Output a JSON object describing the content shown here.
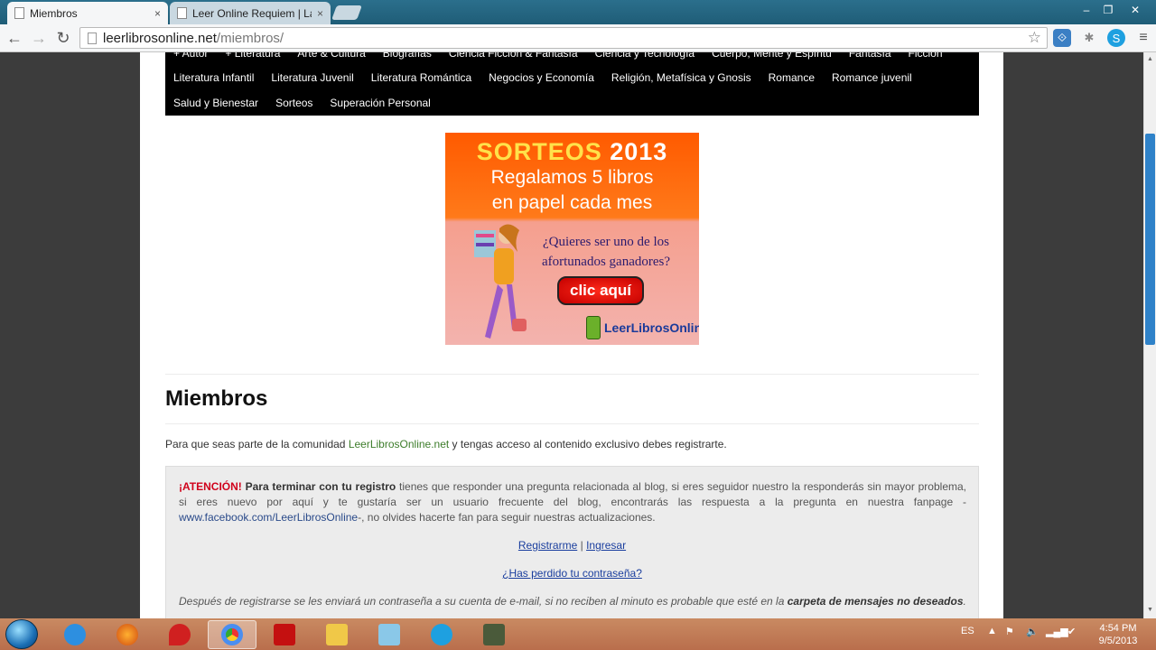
{
  "browser": {
    "tabs": [
      {
        "title": "Miembros",
        "close": "×"
      },
      {
        "title": "Leer Online Requiem | Lau",
        "close": "×"
      }
    ],
    "url_domain": "leerlibrosonline.net",
    "url_path": "/miembros/",
    "window_controls": {
      "minimize": "–",
      "restore": "❐",
      "close": "✕"
    },
    "icons": [
      "back-icon",
      "forward-icon",
      "reload-icon",
      "star-icon",
      "skype-icon",
      "settings-icon"
    ]
  },
  "nav": {
    "row0": [
      "+ Autor",
      "+ Literatura",
      "Arte & Cultura",
      "Biografías",
      "Ciencia Ficción & Fantasía",
      "Ciencia y Tecnología",
      "Cuerpo, Mente y Espíritu",
      "Fantasía",
      "Ficción"
    ],
    "row1": [
      "Literatura Infantil",
      "Literatura Juvenil",
      "Literatura Romántica",
      "Negocios y Economía",
      "Religión, Metafísica y Gnosis",
      "Romance",
      "Romance juvenil"
    ],
    "row2": [
      "Salud y Bienestar",
      "Sorteos",
      "Superación Personal"
    ]
  },
  "banner": {
    "headline": "SORTEOS",
    "year": "2013",
    "line2": "Regalamos 5 libros",
    "line3": "en papel cada mes",
    "question1": "¿Quieres ser uno de los",
    "question2": "afortunados ganadores?",
    "cta": "clic aquí",
    "brand": "LeerLibrosOnline.es"
  },
  "content": {
    "title": "Miembros",
    "intro_pre": "Para que seas parte de la comunidad ",
    "intro_link": "LeerLibrosOnline.net",
    "intro_post": " y tengas acceso al contenido exclusivo debes registrarte.",
    "attention": "¡ATENCIÓN!",
    "attention_bold": "Para terminar con tu registro",
    "attention_text1": " tienes que responder una pregunta relacionada al blog, si eres seguidor nuestro la responderás sin mayor problema, si eres nuevo por aquí y te gustaría ser un usuario frecuente del blog, encontrarás las respuesta a la pregunta en nuestra fanpage -",
    "facebook": "www.facebook.com/LeerLibrosOnline",
    "attention_text2": "-, no olvides hacerte fan para seguir nuestras actualizaciones.",
    "register": "Registrarme",
    "separator": "|",
    "login": "Ingresar",
    "lost_password": "¿Has perdido tu contraseña?",
    "note_text": "Después de registrarse se les enviará un contraseña a su cuenta de e-mail, si no reciben al minuto es probable que esté en la ",
    "note_bold": "carpeta de mensajes no deseados",
    "note_end": "."
  },
  "taskbar": {
    "language": "ES",
    "time": "4:54 PM",
    "date": "9/5/2013"
  }
}
